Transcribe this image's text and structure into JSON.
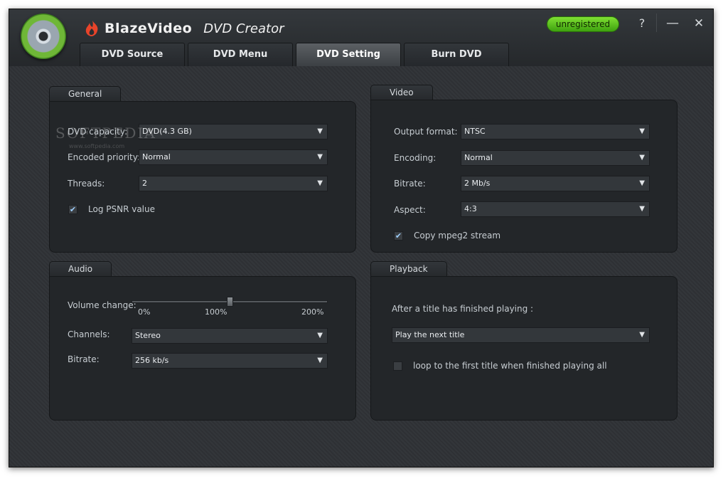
{
  "app": {
    "brand": "BlazeVideo",
    "name": "DVD Creator",
    "registration_status": "unregistered",
    "window_buttons": {
      "help": "?",
      "minimize": "—",
      "close": "✕"
    }
  },
  "tabs": [
    {
      "label": "DVD Source"
    },
    {
      "label": "DVD Menu"
    },
    {
      "label": "DVD Setting"
    },
    {
      "label": "Burn DVD"
    }
  ],
  "active_tab": "DVD Setting",
  "watermark": {
    "text": "SOFTPEDIA",
    "small": "www.softpedia.com"
  },
  "general": {
    "title": "General",
    "dvd_capacity": {
      "label": "DVD capacity:",
      "value": "DVD(4.3 GB)"
    },
    "encoded_priority": {
      "label": "Encoded priority:",
      "value": "Normal"
    },
    "threads": {
      "label": "Threads:",
      "value": "2"
    },
    "log_psnr": {
      "label": "Log PSNR value",
      "checked": true
    }
  },
  "video": {
    "title": "Video",
    "output_format": {
      "label": "Output format:",
      "value": "NTSC"
    },
    "encoding": {
      "label": "Encoding:",
      "value": "Normal"
    },
    "bitrate": {
      "label": "Bitrate:",
      "value": "2 Mb/s"
    },
    "aspect": {
      "label": "Aspect:",
      "value": "4:3"
    },
    "copy_mpeg2": {
      "label": "Copy mpeg2 stream",
      "checked": true
    }
  },
  "audio": {
    "title": "Audio",
    "volume_change": {
      "label": "Volume change:",
      "ticks": [
        "0%",
        "100%",
        "200%"
      ],
      "value_percent": 100
    },
    "channels": {
      "label": "Channels:",
      "value": "Stereo"
    },
    "bitrate": {
      "label": "Bitrate:",
      "value": "256 kb/s"
    }
  },
  "playback": {
    "title": "Playback",
    "after_title_label": "After a title has finished playing :",
    "after_title_value": "Play the next title",
    "loop": {
      "label": "loop to the first title when finished playing all",
      "checked": false
    }
  },
  "icons": {
    "check": "✔",
    "dropdown": "▼"
  }
}
